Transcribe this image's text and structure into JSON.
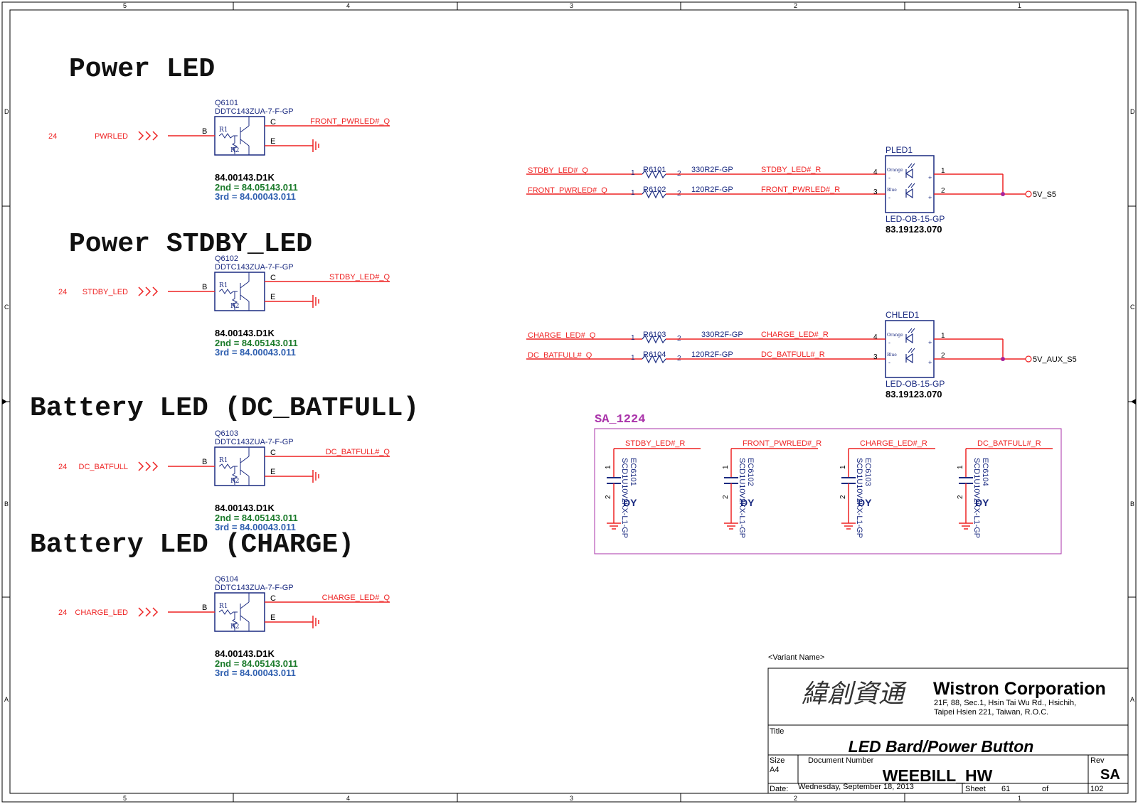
{
  "frame": {
    "col_labels": [
      "5",
      "4",
      "3",
      "2",
      "1"
    ],
    "row_labels": [
      "D",
      "C",
      "B",
      "A"
    ]
  },
  "colors": {
    "net": "#ee2222",
    "part": "#1a2a80",
    "green": "#1a7a2a",
    "blue": "#3060b0",
    "magenta": "#aa33aa"
  },
  "sections": [
    {
      "title": "Power LED",
      "ref": "Q6101",
      "part": "DDTC143ZUA-7-F-GP",
      "sheet": "24",
      "input": "PWRLED",
      "output": "FRONT_PWRLED#_Q",
      "pn1": "84.00143.D1K",
      "pn2": "2nd = 84.05143.011",
      "pn3": "3rd = 84.00043.011"
    },
    {
      "title": "Power STDBY_LED",
      "ref": "Q6102",
      "part": "DDTC143ZUA-7-F-GP",
      "sheet": "24",
      "input": "STDBY_LED",
      "output": "STDBY_LED#_Q",
      "pn1": "84.00143.D1K",
      "pn2": "2nd = 84.05143.011",
      "pn3": "3rd = 84.00043.011"
    },
    {
      "title": "Battery LED (DC_BATFULL)",
      "ref": "Q6103",
      "part": "DDTC143ZUA-7-F-GP",
      "sheet": "24",
      "input": "DC_BATFULL",
      "output": "DC_BATFULL#_Q",
      "pn1": "84.00143.D1K",
      "pn2": "2nd = 84.05143.011",
      "pn3": "3rd = 84.00043.011"
    },
    {
      "title": "Battery LED (CHARGE)",
      "ref": "Q6104",
      "part": "DDTC143ZUA-7-F-GP",
      "sheet": "24",
      "input": "CHARGE_LED",
      "output": "CHARGE_LED#_Q",
      "pn1": "84.00143.D1K",
      "pn2": "2nd = 84.05143.011",
      "pn3": "3rd = 84.00043.011"
    }
  ],
  "pins": {
    "b": "B",
    "c": "C",
    "e": "E",
    "r1": "R1",
    "r2": "R2",
    "p1": "1",
    "p2": "2",
    "p3": "3",
    "p4": "4",
    "plus": "+",
    "minus": "-"
  },
  "leds": [
    {
      "ref": "PLED1",
      "part": "LED-OB-15-GP",
      "pn": "83.19123.070",
      "rail": "5V_S5",
      "orange": "Orange",
      "blue": "Blue",
      "rows": [
        {
          "in_net": "STDBY_LED#_Q",
          "res": "R6101",
          "val": "330R2F-GP",
          "out_net": "STDBY_LED#_R"
        },
        {
          "in_net": "FRONT_PWRLED#_Q",
          "res": "R6102",
          "val": "120R2F-GP",
          "out_net": "FRONT_PWRLED#_R"
        }
      ]
    },
    {
      "ref": "CHLED1",
      "part": "LED-OB-15-GP",
      "pn": "83.19123.070",
      "rail": "5V_AUX_S5",
      "orange": "Orange",
      "blue": "Blue",
      "rows": [
        {
          "in_net": "CHARGE_LED#_Q",
          "res": "R6103",
          "val": "330R2F-GP",
          "out_net": "CHARGE_LED#_R"
        },
        {
          "in_net": "DC_BATFULL#_Q",
          "res": "R6104",
          "val": "120R2F-GP",
          "out_net": "DC_BATFULL#_R"
        }
      ]
    }
  ],
  "caps_group": {
    "label": "SA_1224",
    "caps": [
      {
        "net": "STDBY_LED#_R",
        "ref": "EC6101",
        "part": "SCD1U10V2KX-L1-GP",
        "dy": "DY"
      },
      {
        "net": "FRONT_PWRLED#_R",
        "ref": "EC6102",
        "part": "SCD1U10V2KX-L1-GP",
        "dy": "DY"
      },
      {
        "net": "CHARGE_LED#_R",
        "ref": "EC6103",
        "part": "SCD1U10V2KX-L1-GP",
        "dy": "DY"
      },
      {
        "net": "DC_BATFULL#_R",
        "ref": "EC6104",
        "part": "SCD1U10V2KX-L1-GP",
        "dy": "DY"
      }
    ]
  },
  "title_block": {
    "variant": "<Variant Name>",
    "logo_cn": "緯創資通",
    "company": "Wistron Corporation",
    "addr1": "21F, 88, Sec.1, Hsin Tai Wu Rd., Hsichih,",
    "addr2": "Taipei Hsien 221, Taiwan, R.O.C.",
    "title_label": "Title",
    "title": "LED Bard/Power Button",
    "size_label": "Size",
    "size": "A4",
    "docnum_label": "Document Number",
    "docnum": "WEEBILL_HW",
    "rev_label": "Rev",
    "rev": "SA",
    "date_label": "Date:",
    "date": "Wednesday, September 18, 2013",
    "sheet_label": "Sheet",
    "sheet": "61",
    "of_label": "of",
    "total": "102"
  }
}
